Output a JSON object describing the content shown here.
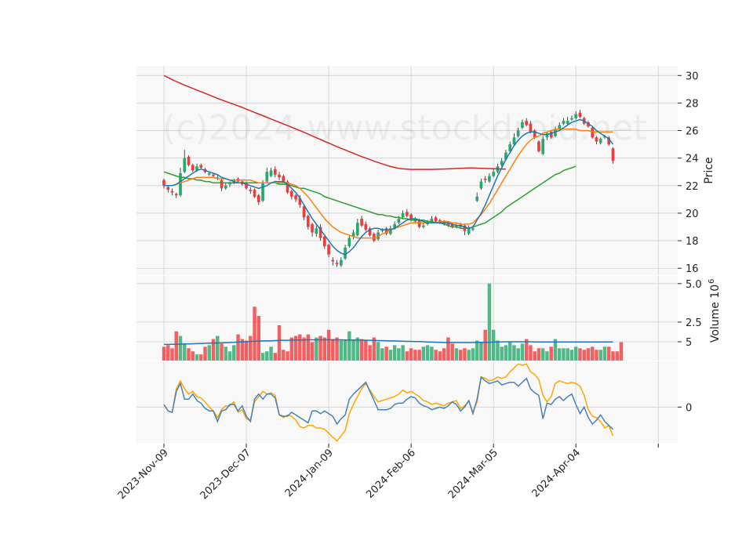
{
  "chart_data": {
    "type": "candlestick",
    "watermark": "(c)2024 www.stockdroid.net",
    "colors": {
      "up": "#26a96c",
      "down": "#ef3b3b",
      "ma_short": "#1f77b4",
      "ma_mid": "#ff7f0e",
      "ma_long": "#2ca02c",
      "ma_longest": "#d62728",
      "vol_avg": "#1f77b4",
      "osc_a": "#4682b4",
      "osc_b": "#ffa500",
      "panel_bg": "#f8f8f8",
      "grid": "#d0d0d0"
    },
    "price_panel": {
      "ylabel": "Price",
      "ylim": [
        15.5,
        30.7
      ],
      "yticks": [
        16,
        18,
        20,
        22,
        24,
        26,
        28,
        30
      ]
    },
    "volume_panel": {
      "ylabel": "Volume",
      "ylabel_exp": "6",
      "ylim": [
        0,
        5.5
      ],
      "yticks": [
        2.5,
        5.0
      ],
      "ytick_labels": [
        "2.5",
        "5.0"
      ]
    },
    "osc_panel": {
      "ylim": [
        -2.8,
        3.5
      ],
      "yticks": [
        0,
        5
      ],
      "ytick_labels": [
        "0",
        "5"
      ]
    },
    "x_ticks": [
      {
        "index": 0,
        "label": "2023-Nov-09"
      },
      {
        "index": 20,
        "label": "2023-Dec-07"
      },
      {
        "index": 40,
        "label": "2024-Jan-09"
      },
      {
        "index": 60,
        "label": "2024-Feb-06"
      },
      {
        "index": 80,
        "label": "2024-Mar-05"
      },
      {
        "index": 100,
        "label": "2024-Apr-04"
      },
      {
        "index": 120,
        "label": ""
      }
    ],
    "n_bars": 120,
    "close": [
      22.0,
      21.7,
      21.5,
      21.3,
      22.9,
      24.0,
      23.5,
      23.1,
      23.4,
      23.3,
      23.0,
      22.9,
      22.7,
      22.6,
      21.8,
      22.0,
      22.2,
      22.4,
      22.3,
      22.1,
      21.8,
      21.6,
      21.2,
      20.8,
      22.2,
      23.0,
      23.1,
      22.8,
      22.6,
      22.3,
      21.5,
      21.2,
      21.0,
      20.6,
      19.7,
      19.0,
      18.6,
      18.9,
      18.2,
      17.6,
      17.0,
      16.5,
      16.3,
      16.6,
      17.5,
      18.2,
      18.6,
      19.3,
      19.1,
      18.8,
      18.4,
      18.0,
      18.6,
      18.8,
      18.5,
      18.9,
      19.2,
      19.6,
      20.0,
      19.8,
      19.5,
      19.4,
      19.0,
      19.1,
      19.3,
      19.6,
      19.4,
      19.3,
      19.2,
      19.1,
      19.0,
      19.1,
      19.0,
      18.7,
      18.9,
      18.9,
      21.2,
      22.3,
      22.4,
      22.7,
      23.0,
      23.4,
      23.8,
      24.4,
      25.0,
      25.5,
      26.0,
      26.6,
      26.4,
      25.9,
      25.5,
      24.5,
      25.4,
      25.8,
      25.5,
      26.1,
      26.4,
      26.7,
      26.7,
      26.9,
      27.2,
      27.0,
      26.5,
      26.3,
      25.5,
      25.2,
      25.4,
      25.6,
      25.0,
      23.8
    ],
    "open": [
      22.4,
      21.9,
      21.6,
      21.4,
      21.3,
      23.0,
      24.1,
      23.5,
      23.1,
      23.5,
      23.2,
      22.8,
      22.8,
      22.6,
      22.4,
      21.8,
      22.1,
      22.2,
      22.5,
      22.3,
      22.2,
      21.7,
      21.7,
      21.3,
      20.9,
      22.3,
      22.7,
      23.2,
      22.8,
      22.7,
      22.3,
      21.6,
      21.3,
      21.1,
      20.5,
      19.8,
      19.2,
      18.5,
      19.0,
      18.3,
      17.7,
      16.6,
      16.4,
      16.2,
      16.7,
      17.6,
      18.3,
      18.4,
      19.6,
      19.2,
      18.9,
      18.5,
      18.1,
      18.7,
      18.9,
      18.5,
      18.9,
      19.3,
      19.7,
      20.1,
      19.9,
      19.6,
      19.5,
      19.0,
      19.2,
      19.4,
      19.7,
      19.5,
      19.4,
      19.3,
      19.2,
      19.1,
      19.2,
      19.1,
      18.5,
      18.8,
      20.9,
      21.8,
      22.5,
      22.3,
      22.7,
      23.0,
      23.5,
      23.9,
      24.5,
      25.0,
      25.6,
      26.2,
      26.7,
      26.5,
      26.0,
      25.2,
      24.3,
      25.5,
      25.9,
      25.6,
      26.1,
      26.5,
      26.5,
      26.8,
      26.9,
      27.3,
      26.9,
      26.6,
      26.2,
      25.5,
      25.1,
      25.5,
      25.5,
      24.7
    ],
    "high": [
      22.5,
      22.0,
      21.8,
      21.5,
      23.3,
      24.6,
      24.2,
      23.6,
      23.6,
      23.6,
      23.3,
      23.0,
      22.9,
      22.8,
      22.5,
      22.2,
      22.3,
      22.5,
      22.6,
      22.4,
      22.3,
      21.9,
      21.8,
      21.4,
      22.4,
      23.3,
      23.3,
      23.4,
      23.0,
      22.8,
      22.4,
      21.7,
      21.4,
      21.3,
      20.6,
      19.9,
      19.3,
      19.1,
      19.2,
      18.4,
      17.8,
      16.8,
      16.6,
      16.8,
      17.7,
      18.4,
      18.8,
      19.6,
      19.8,
      19.4,
      19.0,
      18.6,
      18.8,
      18.9,
      19.0,
      19.1,
      19.4,
      19.8,
      20.2,
      20.3,
      20.0,
      19.7,
      19.6,
      19.3,
      19.5,
      19.8,
      19.8,
      19.6,
      19.5,
      19.4,
      19.3,
      19.3,
      19.3,
      19.2,
      19.1,
      19.1,
      21.5,
      22.5,
      22.7,
      22.9,
      23.2,
      23.6,
      24.0,
      24.6,
      25.2,
      25.8,
      26.2,
      26.8,
      26.9,
      26.7,
      26.1,
      25.3,
      25.6,
      25.9,
      26.0,
      26.3,
      26.6,
      26.9,
      27.0,
      27.1,
      27.4,
      27.5,
      27.0,
      26.7,
      26.3,
      25.6,
      25.5,
      25.7,
      25.6,
      24.8
    ],
    "low": [
      21.8,
      21.5,
      21.3,
      21.1,
      21.2,
      22.9,
      23.4,
      23.0,
      23.0,
      23.2,
      22.9,
      22.7,
      22.6,
      22.4,
      21.6,
      21.7,
      21.9,
      22.1,
      22.2,
      22.0,
      21.7,
      21.4,
      21.1,
      20.6,
      20.8,
      22.2,
      22.6,
      22.6,
      22.4,
      22.2,
      21.4,
      21.0,
      20.8,
      20.4,
      19.5,
      18.8,
      18.3,
      18.3,
      18.0,
      17.4,
      16.8,
      16.2,
      16.1,
      16.1,
      16.6,
      17.5,
      18.1,
      18.3,
      19.0,
      18.7,
      18.3,
      17.9,
      18.0,
      18.6,
      18.4,
      18.4,
      18.8,
      19.2,
      19.6,
      19.7,
      19.4,
      19.3,
      18.9,
      18.9,
      19.1,
      19.3,
      19.3,
      19.2,
      19.1,
      19.0,
      18.9,
      18.9,
      18.9,
      18.4,
      18.4,
      18.7,
      20.8,
      21.7,
      22.2,
      22.2,
      22.6,
      22.9,
      23.4,
      23.8,
      24.4,
      24.9,
      25.5,
      26.1,
      26.3,
      25.8,
      25.4,
      24.4,
      24.2,
      25.3,
      25.4,
      25.5,
      26.0,
      26.4,
      26.4,
      26.7,
      26.8,
      26.9,
      26.4,
      26.2,
      25.4,
      25.0,
      25.0,
      25.4,
      24.9,
      23.6
    ],
    "ma_short": [
      22.0,
      22.0,
      22.0,
      22.1,
      22.3,
      22.5,
      22.7,
      22.9,
      23.1,
      23.2,
      23.1,
      23.0,
      22.9,
      22.8,
      22.6,
      22.5,
      22.4,
      22.3,
      22.2,
      22.2,
      22.1,
      22.0,
      21.9,
      21.8,
      21.9,
      22.0,
      22.2,
      22.3,
      22.3,
      22.3,
      22.1,
      21.8,
      21.5,
      21.1,
      20.6,
      20.1,
      19.6,
      19.2,
      18.8,
      18.4,
      18.0,
      17.6,
      17.3,
      17.1,
      17.0,
      17.2,
      17.5,
      17.9,
      18.3,
      18.6,
      18.8,
      18.9,
      18.9,
      18.8,
      18.8,
      18.8,
      18.9,
      19.1,
      19.3,
      19.5,
      19.6,
      19.6,
      19.5,
      19.4,
      19.3,
      19.3,
      19.3,
      19.3,
      19.3,
      19.3,
      19.2,
      19.1,
      19.1,
      19.0,
      18.9,
      19.0,
      19.5,
      20.0,
      20.6,
      21.3,
      22.0,
      22.7,
      23.3,
      23.9,
      24.4,
      24.9,
      25.3,
      25.6,
      25.8,
      25.9,
      25.9,
      25.8,
      25.7,
      25.7,
      25.8,
      25.9,
      26.0,
      26.2,
      26.4,
      26.6,
      26.7,
      26.8,
      26.7,
      26.5,
      26.3,
      26.0,
      25.8,
      25.6,
      25.4,
      25.0
    ],
    "ma_mid": [
      22.0,
      22.0,
      22.0,
      22.1,
      22.2,
      22.3,
      22.4,
      22.5,
      22.6,
      22.6,
      22.6,
      22.6,
      22.6,
      22.5,
      22.5,
      22.5,
      22.4,
      22.4,
      22.4,
      22.4,
      22.4,
      22.4,
      22.3,
      22.2,
      22.2,
      22.2,
      22.2,
      22.2,
      22.2,
      22.2,
      22.2,
      22.1,
      22.0,
      21.8,
      21.5,
      21.2,
      20.8,
      20.4,
      20.0,
      19.6,
      19.3,
      19.0,
      18.8,
      18.6,
      18.5,
      18.4,
      18.3,
      18.2,
      18.2,
      18.2,
      18.2,
      18.2,
      18.3,
      18.5,
      18.6,
      18.8,
      18.9,
      19.0,
      19.1,
      19.2,
      19.3,
      19.3,
      19.3,
      19.3,
      19.3,
      19.3,
      19.3,
      19.4,
      19.4,
      19.4,
      19.3,
      19.3,
      19.2,
      19.2,
      19.2,
      19.3,
      19.6,
      19.9,
      20.3,
      20.7,
      21.2,
      21.7,
      22.2,
      22.7,
      23.2,
      23.7,
      24.2,
      24.6,
      25.0,
      25.3,
      25.5,
      25.6,
      25.8,
      25.9,
      26.0,
      26.1,
      26.1,
      26.1,
      26.1,
      26.1,
      26.1,
      26.0,
      26.0,
      26.0,
      25.9,
      25.9,
      25.9,
      25.9,
      25.9,
      25.9
    ],
    "ma_long": [
      23.0,
      22.9,
      22.8,
      22.7,
      22.6,
      22.6,
      22.5,
      22.5,
      22.4,
      22.4,
      22.3,
      22.3,
      22.2,
      22.2,
      22.2,
      22.2,
      22.2,
      22.2,
      22.2,
      22.2,
      22.2,
      22.2,
      22.2,
      22.2,
      22.2,
      22.2,
      22.2,
      22.2,
      22.1,
      22.1,
      22.1,
      22.0,
      21.9,
      21.8,
      21.8,
      21.7,
      21.6,
      21.5,
      21.4,
      21.2,
      21.1,
      21.0,
      20.9,
      20.8,
      20.7,
      20.6,
      20.5,
      20.4,
      20.3,
      20.2,
      20.1,
      20.0,
      19.9,
      19.9,
      19.8,
      19.8,
      19.7,
      19.7,
      19.6,
      19.6,
      19.5,
      19.5,
      19.5,
      19.5,
      19.4,
      19.4,
      19.3,
      19.3,
      19.2,
      19.1,
      19.0,
      19.0,
      18.9,
      18.9,
      18.9,
      19.0,
      19.1,
      19.2,
      19.3,
      19.5,
      19.7,
      19.9,
      20.1,
      20.4,
      20.6,
      20.8,
      21.0,
      21.2,
      21.4,
      21.6,
      21.8,
      22.0,
      22.2,
      22.4,
      22.6,
      22.8,
      22.9,
      23.1,
      23.2,
      23.3,
      23.4
    ],
    "ma_longest": [
      30.0,
      29.85,
      29.7,
      29.56,
      29.43,
      29.3,
      29.18,
      29.06,
      28.94,
      28.82,
      28.7,
      28.58,
      28.46,
      28.34,
      28.23,
      28.12,
      28.01,
      27.9,
      27.79,
      27.68,
      27.56,
      27.44,
      27.32,
      27.2,
      27.08,
      26.96,
      26.84,
      26.72,
      26.6,
      26.48,
      26.36,
      26.24,
      26.12,
      26.0,
      25.87,
      25.74,
      25.61,
      25.48,
      25.35,
      25.22,
      25.09,
      24.96,
      24.83,
      24.71,
      24.59,
      24.47,
      24.35,
      24.23,
      24.11,
      24.0,
      23.89,
      23.78,
      23.68,
      23.58,
      23.48,
      23.39,
      23.32,
      23.26,
      23.22,
      23.2,
      23.18,
      23.18,
      23.18,
      23.18,
      23.18,
      23.18,
      23.19,
      23.2,
      23.21,
      23.22,
      23.23,
      23.25,
      23.26,
      23.27,
      23.28,
      23.28,
      23.27,
      23.26,
      23.25,
      23.24,
      23.23,
      23.22,
      23.21,
      23.2
    ],
    "volume": [
      0.9,
      1.0,
      0.8,
      1.9,
      1.6,
      1.1,
      0.8,
      0.6,
      0.4,
      0.4,
      0.9,
      1.0,
      1.4,
      1.6,
      1.1,
      0.9,
      0.6,
      1.0,
      1.7,
      1.4,
      1.3,
      1.6,
      3.5,
      2.9,
      0.5,
      0.6,
      0.9,
      0.5,
      2.3,
      0.7,
      0.6,
      1.5,
      1.6,
      1.7,
      1.5,
      1.7,
      1.2,
      1.5,
      1.6,
      1.5,
      2.0,
      1.4,
      1.5,
      1.3,
      1.3,
      1.9,
      1.3,
      1.5,
      1.4,
      1.3,
      1.0,
      1.5,
      1.2,
      0.8,
      0.9,
      0.7,
      1.0,
      0.8,
      1.0,
      0.6,
      0.8,
      0.7,
      0.7,
      0.9,
      1.0,
      0.9,
      0.7,
      0.6,
      0.8,
      1.5,
      1.1,
      0.8,
      0.7,
      0.8,
      0.7,
      0.8,
      1.3,
      1.2,
      2.0,
      5.0,
      2.0,
      1.3,
      0.9,
      1.0,
      1.2,
      1.0,
      0.8,
      1.1,
      1.4,
      1.0,
      0.6,
      0.8,
      0.8,
      0.6,
      0.9,
      1.4,
      0.8,
      0.8,
      0.8,
      0.7,
      0.9,
      0.8,
      0.7,
      0.8,
      0.9,
      0.7,
      0.7,
      0.9,
      0.9,
      0.6,
      0.6,
      1.2
    ],
    "volume_avg": [
      1.05,
      1.05,
      1.06,
      1.06,
      1.07,
      1.08,
      1.08,
      1.09,
      1.1,
      1.11,
      1.12,
      1.13,
      1.13,
      1.14,
      1.15,
      1.16,
      1.17,
      1.18,
      1.2,
      1.21,
      1.22,
      1.24,
      1.26,
      1.27,
      1.28,
      1.28,
      1.29,
      1.3,
      1.31,
      1.32,
      1.32,
      1.33,
      1.33,
      1.34,
      1.34,
      1.35,
      1.35,
      1.35,
      1.35,
      1.35,
      1.35,
      1.35,
      1.35,
      1.35,
      1.34,
      1.34,
      1.34,
      1.33,
      1.33,
      1.32,
      1.32,
      1.31,
      1.3,
      1.3,
      1.29,
      1.28,
      1.28,
      1.27,
      1.26,
      1.25,
      1.25,
      1.24,
      1.23,
      1.22,
      1.21,
      1.2,
      1.19,
      1.18,
      1.17,
      1.17,
      1.17,
      1.17,
      1.17,
      1.17,
      1.17,
      1.17,
      1.18,
      1.18,
      1.18,
      1.19,
      1.2,
      1.21,
      1.21,
      1.22,
      1.22,
      1.22,
      1.22,
      1.22,
      1.22,
      1.22,
      1.21,
      1.21,
      1.21,
      1.21,
      1.21,
      1.21,
      1.21,
      1.21,
      1.21,
      1.21,
      1.21,
      1.21,
      1.21,
      1.21,
      1.21,
      1.21,
      1.21,
      1.21,
      1.21,
      1.21
    ],
    "osc_a": [
      0.2,
      -0.3,
      -0.4,
      1.2,
      1.8,
      0.6,
      0.6,
      1.0,
      0.5,
      0.3,
      -0.1,
      -0.3,
      -0.3,
      -1.1,
      -0.3,
      -0.2,
      0.2,
      0.2,
      -0.3,
      0.1,
      -0.7,
      -1.1,
      0.6,
      1.0,
      0.6,
      1.0,
      1.0,
      0.7,
      -0.6,
      -0.7,
      -0.7,
      -0.4,
      -0.6,
      -0.8,
      -1.0,
      -1.2,
      -0.3,
      -0.3,
      -0.5,
      -0.3,
      -0.5,
      -0.7,
      -1.3,
      -0.9,
      -0.6,
      0.6,
      1.0,
      1.3,
      1.6,
      1.9,
      1.2,
      0.5,
      -0.2,
      -0.2,
      -0.2,
      -0.1,
      0.2,
      0.3,
      0.3,
      0.6,
      0.8,
      0.7,
      0.3,
      0.1,
      0.0,
      -0.2,
      -0.1,
      0.0,
      -0.1,
      0.1,
      0.4,
      0.2,
      -0.3,
      0.0,
      0.5,
      -0.5,
      0.6,
      2.3,
      2.0,
      1.8,
      1.9,
      2.0,
      1.7,
      1.8,
      1.9,
      1.9,
      1.6,
      1.9,
      2.2,
      1.4,
      1.1,
      0.9,
      -0.9,
      0.3,
      0.2,
      0.6,
      0.8,
      0.5,
      0.8,
      1.0,
      0.2,
      -0.5,
      0.0,
      -0.8,
      -1.3,
      -1.0,
      -0.6,
      -1.1,
      -1.4,
      -1.7
    ],
    "osc_b": [
      0.2,
      -0.3,
      -0.4,
      1.4,
      2.0,
      1.4,
      1.0,
      1.2,
      0.8,
      0.7,
      0.4,
      0.0,
      -0.3,
      -0.8,
      -0.2,
      0.1,
      0.1,
      0.4,
      -0.4,
      -0.2,
      -0.9,
      -1.0,
      0.4,
      0.8,
      1.2,
      1.0,
      1.1,
      0.9,
      -0.6,
      -0.8,
      -0.6,
      -0.7,
      -1.0,
      -1.5,
      -1.6,
      -1.4,
      -1.4,
      -1.6,
      -1.6,
      -1.7,
      -2.0,
      -2.3,
      -2.6,
      -2.2,
      -1.8,
      -0.5,
      0.2,
      0.8,
      1.4,
      1.8,
      1.3,
      0.8,
      0.4,
      0.5,
      0.6,
      0.7,
      0.8,
      1.0,
      1.3,
      1.1,
      1.2,
      1.0,
      0.8,
      0.5,
      0.4,
      0.2,
      0.3,
      0.2,
      0.1,
      0.3,
      0.4,
      0.5,
      -0.1,
      0.1,
      0.5,
      -0.4,
      0.4,
      2.3,
      2.2,
      2.0,
      2.1,
      2.3,
      2.2,
      2.3,
      2.7,
      3.0,
      3.3,
      3.2,
      3.3,
      2.7,
      2.5,
      2.1,
      0.9,
      0.4,
      0.8,
      1.8,
      2.0,
      1.9,
      1.8,
      1.9,
      1.8,
      1.6,
      0.9,
      -0.2,
      -0.7,
      -0.8,
      -1.1,
      -1.6,
      -1.4,
      -2.2
    ]
  }
}
